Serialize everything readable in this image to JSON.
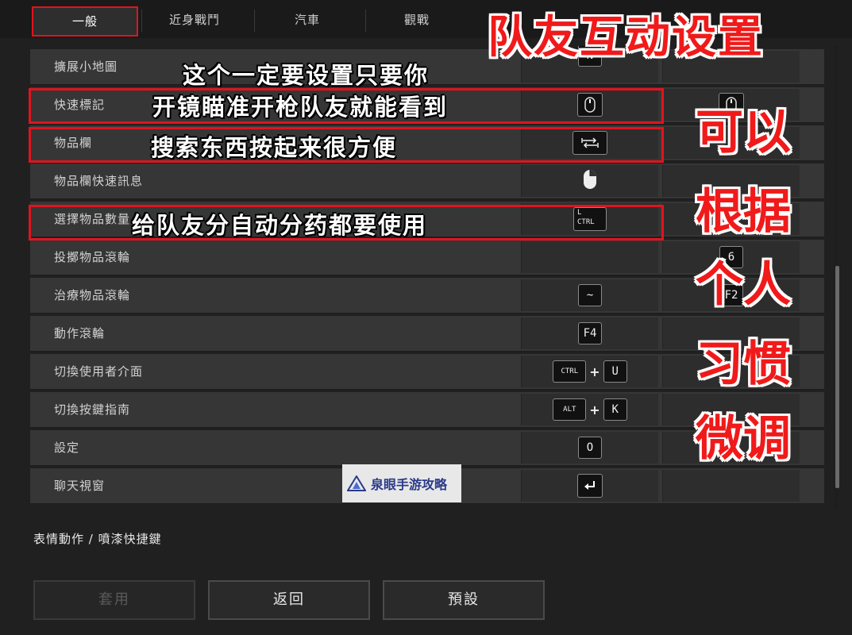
{
  "tabs": [
    {
      "label": "一般",
      "active": true
    },
    {
      "label": "近身戰鬥",
      "active": false
    },
    {
      "label": "汽車",
      "active": false
    },
    {
      "label": "觀戰",
      "active": false
    }
  ],
  "rows": [
    {
      "label": "擴展小地圖",
      "key1": "N",
      "key2": ""
    },
    {
      "label": "快速標記",
      "key1_icon": "mouse-middle-icon",
      "key2_icon": "mouse-middle-icon"
    },
    {
      "label": "物品欄",
      "key1_icon": "tab-key-icon",
      "key2": ""
    },
    {
      "label": "物品欄快速訊息",
      "key1_icon": "mouse-right-icon",
      "key2": ""
    },
    {
      "label": "選擇物品數量",
      "key1": "L CTRL",
      "key2": ""
    },
    {
      "label": "投擲物品滾輪",
      "key1": "",
      "key2": "6"
    },
    {
      "label": "治療物品滾輪",
      "key1": "~",
      "key2": "F2"
    },
    {
      "label": "動作滾輪",
      "key1": "F4",
      "key2": ""
    },
    {
      "label": "切換使用者介面",
      "key1a": "CTRL",
      "plus": "+",
      "key1b": "U"
    },
    {
      "label": "切換按鍵指南",
      "key1a": "ALT",
      "plus": "+",
      "key1b": "K"
    },
    {
      "label": "設定",
      "key1": "O",
      "key2": ""
    },
    {
      "label": "聊天視窗",
      "key1_icon": "enter-key-icon",
      "key2": ""
    }
  ],
  "section_title": "表情動作 / 噴漆快捷鍵",
  "buttons": {
    "apply": "套用",
    "back": "返回",
    "default": "預設"
  },
  "overlay": {
    "title": "队友互动设置",
    "note1_line1": "这个一定要设置只要你",
    "note1_line2": "开镜瞄准开枪队友就能看到",
    "note2": "搜索东西按起来很方便",
    "note3": "给队友分自动分药都要使用",
    "side": [
      "可以",
      "根据",
      "个人",
      "习惯",
      "微调"
    ]
  },
  "watermark": "泉眼手游攻略",
  "colors": {
    "highlight": "#e0141e",
    "overlay_red": "#f01a1a",
    "watermark_text": "#2b3a8a"
  }
}
